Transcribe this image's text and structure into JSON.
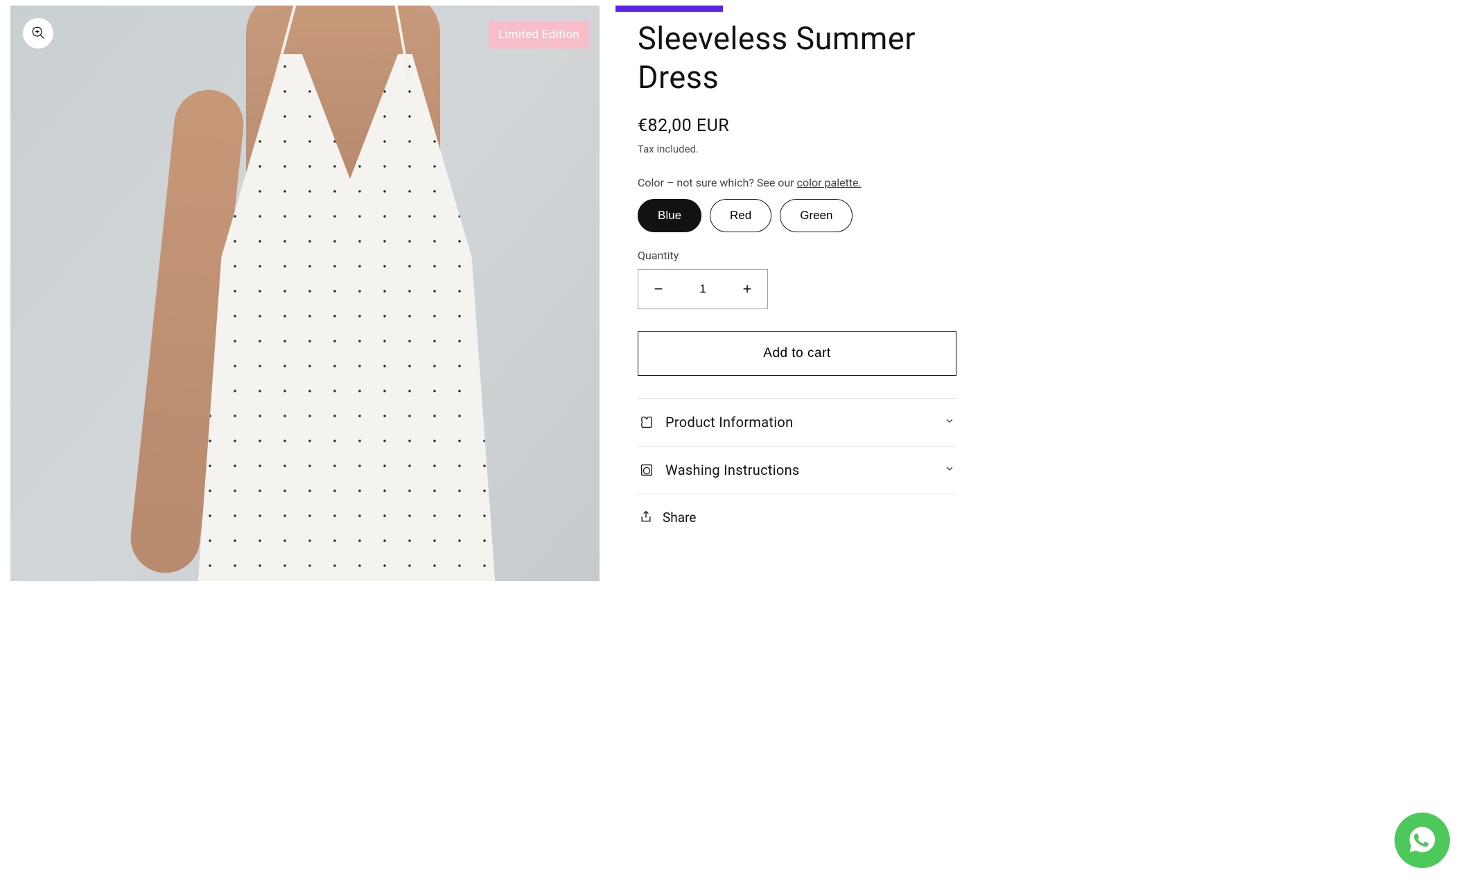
{
  "product": {
    "badge": "Limited Edition",
    "title": "Sleeveless Summer Dress",
    "price": "€82,00 EUR",
    "tax_note": "Tax included.",
    "color_label_prefix": "Color – not sure which? See our ",
    "color_palette_link": "color palette.",
    "colors": [
      "Blue",
      "Red",
      "Green"
    ],
    "selected_color_index": 0,
    "quantity_label": "Quantity",
    "quantity_value": "1",
    "add_to_cart": "Add to cart",
    "accordion": [
      {
        "title": "Product Information"
      },
      {
        "title": "Washing Instructions"
      }
    ],
    "share_label": "Share"
  }
}
